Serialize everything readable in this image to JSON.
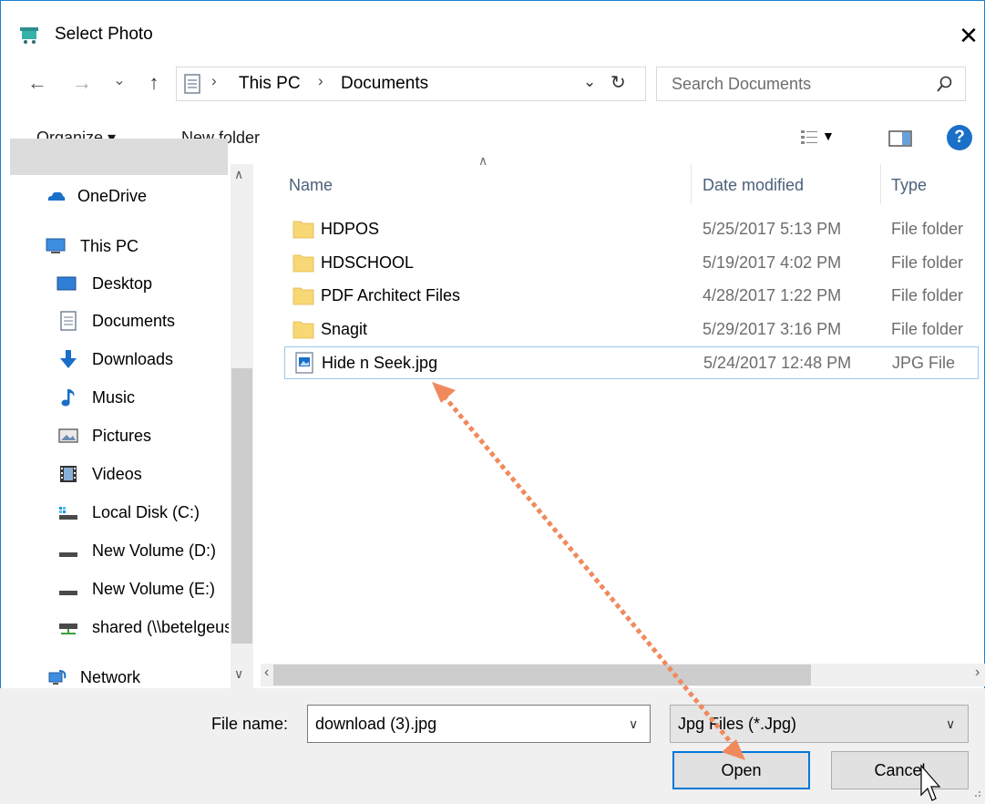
{
  "window": {
    "title": "Select Photo",
    "close_glyph": "✕"
  },
  "nav": {
    "back_glyph": "←",
    "forward_glyph": "→",
    "recent_glyph": "⌄",
    "up_glyph": "↑",
    "breadcrumb": [
      "This PC",
      "Documents"
    ],
    "breadcrumb_sep": "›",
    "search_placeholder": "Search Documents"
  },
  "toolbar": {
    "organize_label": "Organize ▾",
    "new_folder_label": "New folder"
  },
  "sidebar": {
    "items": [
      {
        "label": "OneDrive",
        "icon": "onedrive-icon"
      },
      {
        "label": "This PC",
        "icon": "computer-icon"
      },
      {
        "label": "Desktop",
        "icon": "desktop-icon"
      },
      {
        "label": "Documents",
        "icon": "documents-icon",
        "selected": true
      },
      {
        "label": "Downloads",
        "icon": "download-icon"
      },
      {
        "label": "Music",
        "icon": "music-icon"
      },
      {
        "label": "Pictures",
        "icon": "pictures-icon"
      },
      {
        "label": "Videos",
        "icon": "videos-icon"
      },
      {
        "label": "Local Disk (C:)",
        "icon": "local-disk-icon"
      },
      {
        "label": "New Volume (D:)",
        "icon": "drive-icon"
      },
      {
        "label": "New Volume (E:)",
        "icon": "drive-icon"
      },
      {
        "label": "shared (\\\\betelgeuse)",
        "icon": "network-drive-icon"
      },
      {
        "label": "Network",
        "icon": "network-icon"
      }
    ]
  },
  "files": {
    "columns": [
      "Name",
      "Date modified",
      "Type"
    ],
    "rows": [
      {
        "name": "HDPOS",
        "date": "5/25/2017 5:13 PM",
        "type": "File folder",
        "icon": "folder-icon"
      },
      {
        "name": "HDSCHOOL",
        "date": "5/19/2017 4:02 PM",
        "type": "File folder",
        "icon": "folder-icon"
      },
      {
        "name": "PDF Architect Files",
        "date": "4/28/2017 1:22 PM",
        "type": "File folder",
        "icon": "folder-icon"
      },
      {
        "name": "Snagit",
        "date": "5/29/2017 3:16 PM",
        "type": "File folder",
        "icon": "folder-icon"
      },
      {
        "name": "Hide n Seek.jpg",
        "date": "5/24/2017 12:48 PM",
        "type": "JPG File",
        "icon": "image-file-icon",
        "selected": true
      }
    ]
  },
  "bottom": {
    "file_name_label": "File name:",
    "file_name_value": "download (3).jpg",
    "file_type_value": "Jpg Files  (*.Jpg)",
    "open_label": "Open",
    "cancel_label": "Cancel"
  },
  "colors": {
    "accent": "#0078d7",
    "folder": "#f8d775",
    "annotation_arrow": "#f08a5d",
    "selection": "#dcdcdc"
  }
}
